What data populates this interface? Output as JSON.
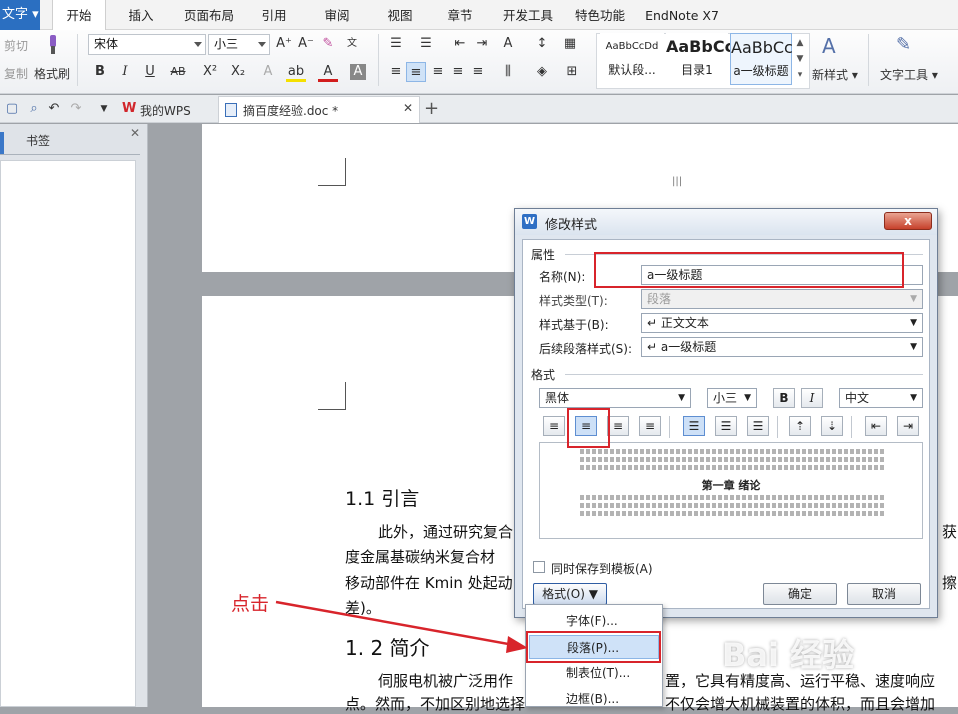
{
  "menubar": {
    "app_button": "文字",
    "tabs": [
      "开始",
      "插入",
      "页面布局",
      "引用",
      "审阅",
      "视图",
      "章节",
      "开发工具",
      "特色功能",
      "EndNote X7"
    ],
    "active_tab": "开始"
  },
  "ribbon": {
    "cut": "剪切",
    "copy": "复制",
    "format_painter": "格式刷",
    "font_name": "宋体",
    "font_size": "小三",
    "styles": [
      {
        "preview": "AaBbCcDd",
        "name": "默认段..."
      },
      {
        "preview": "AaBbCc",
        "name": "目录1"
      },
      {
        "preview": "AaBbCc",
        "name": "a一级标题"
      }
    ],
    "new_style": "新样式",
    "text_tools": "文字工具"
  },
  "tabbar": {
    "wps_tab": "我的WPS",
    "doc_tab": "摘百度经验.doc *"
  },
  "left_panel": {
    "tab_label": "书签"
  },
  "document": {
    "heading_1": "1.1 引言",
    "para_1_line_1": "此外，通过研究复合",
    "para_1_line_1_right": "获",
    "para_1_line_2": "度金属基碳纳米复合材",
    "para_1_line_3": "移动部件在 Kmin 处起动",
    "para_1_line_3_right": "擦",
    "para_1_line_4": "差)。",
    "heading_2": "1. 2  简介",
    "para_2_line_1_left": "伺服电机被广泛用作",
    "para_2_line_1_right": "置，它具有精度高、运行平稳、速度响应",
    "para_2_line_2_left": "点。然而，不加区别地选择",
    "para_2_line_2_right": "不仅会增大机械装置的体积，而且会增加"
  },
  "dialog": {
    "title": "修改样式",
    "close_label": "x",
    "section_properties": "属性",
    "name_label": "名称(N):",
    "name_value": "a一级标题",
    "type_label": "样式类型(T):",
    "type_value": "段落",
    "based_on_label": "样式基于(B):",
    "based_on_value": "↵ 正文文本",
    "next_style_label": "后续段落样式(S):",
    "next_style_value": "↵ a一级标题",
    "section_format": "格式",
    "font_value": "黑体",
    "size_value": "小三",
    "bold": "B",
    "italic": "I",
    "lang_value": "中文",
    "preview_heading": "第一章  绪论",
    "save_to_template": "同时保存到模板(A)",
    "format_button": "格式(O)",
    "ok": "确定",
    "cancel": "取消"
  },
  "format_menu": [
    "字体(F)...",
    "段落(P)...",
    "制表位(T)...",
    "边框(B)..."
  ],
  "annotation": {
    "text": "点击",
    "color": "#d8242b"
  },
  "watermark": "Bai 经验"
}
